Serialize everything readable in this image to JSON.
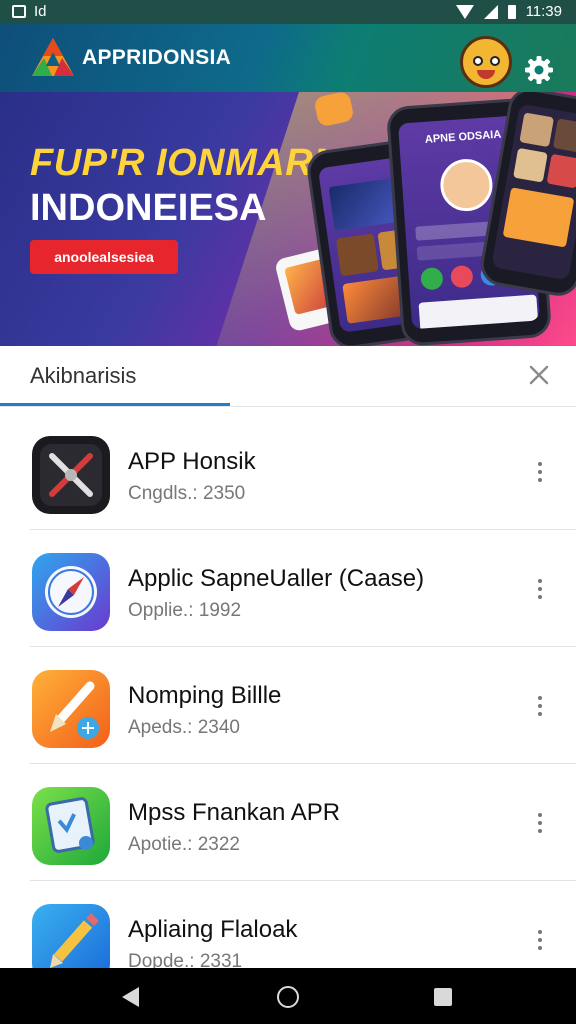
{
  "status_bar": {
    "left_text": "Id",
    "time": "11:39"
  },
  "app_bar": {
    "title": "APPRIDONSIA"
  },
  "banner": {
    "headline": "FUP'R IONMARN",
    "subheadline": "INDONEIESA",
    "pill_label": "anoolealsesiea",
    "phone_screen_title": "APNE ODSAIA"
  },
  "search": {
    "query": "Akibnarisis"
  },
  "apps": [
    {
      "name": "APP Honsik",
      "meta": "Cngdls.: 2350",
      "icon": "tools-icon"
    },
    {
      "name": "Applic SapneUaller (Caase)",
      "meta": "Opplie.: 1992",
      "icon": "compass-icon"
    },
    {
      "name": "Nomping Billle",
      "meta": "Apeds.: 2340",
      "icon": "brush-icon"
    },
    {
      "name": "Mpss Fnankan APR",
      "meta": "Apotie.: 2322",
      "icon": "tablet-icon"
    },
    {
      "name": "Apliaing Flaloak",
      "meta": "Dopde.: 2331",
      "icon": "pencil-icon"
    }
  ],
  "colors": {
    "status_bar": "#1f4f47",
    "app_bar": "#0e6a8a",
    "accent": "#1e7fd1",
    "pill": "#e6262c"
  }
}
